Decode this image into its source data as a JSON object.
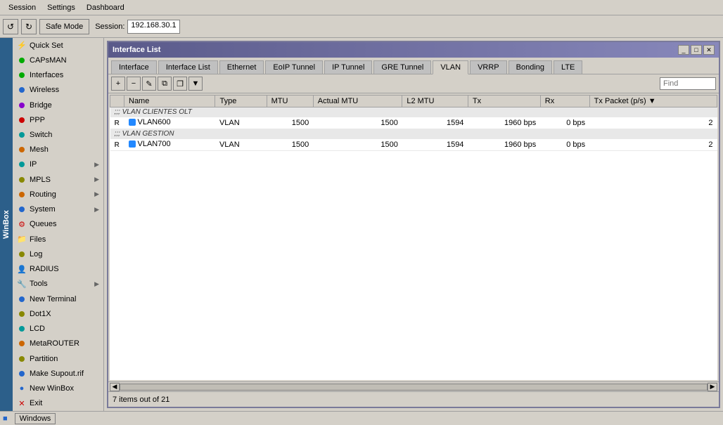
{
  "menubar": {
    "items": [
      "Session",
      "Settings",
      "Dashboard"
    ]
  },
  "toolbar": {
    "undo_label": "↺",
    "redo_label": "↻",
    "safemode_label": "Safe Mode",
    "session_label": "Session:",
    "session_value": "192.168.30.1"
  },
  "sidebar": {
    "items": [
      {
        "id": "quick-set",
        "label": "Quick Set",
        "icon": "⚡",
        "color": "#cc6600"
      },
      {
        "id": "capsman",
        "label": "CAPsMAN",
        "icon": "■",
        "color": "#00aa00"
      },
      {
        "id": "interfaces",
        "label": "Interfaces",
        "icon": "■",
        "color": "#00aa00",
        "active": true
      },
      {
        "id": "wireless",
        "label": "Wireless",
        "icon": "■",
        "color": "#0055cc"
      },
      {
        "id": "bridge",
        "label": "Bridge",
        "icon": "■",
        "color": "#8800aa"
      },
      {
        "id": "ppp",
        "label": "PPP",
        "icon": "■",
        "color": "#cc0000"
      },
      {
        "id": "switch",
        "label": "Switch",
        "icon": "■",
        "color": "#006688"
      },
      {
        "id": "mesh",
        "label": "Mesh",
        "icon": "■",
        "color": "#cc6600"
      },
      {
        "id": "ip",
        "label": "IP",
        "icon": "■",
        "color": "#006688",
        "expandable": true
      },
      {
        "id": "mpls",
        "label": "MPLS",
        "icon": "■",
        "color": "#888800",
        "expandable": true
      },
      {
        "id": "routing",
        "label": "Routing",
        "icon": "■",
        "color": "#cc6600",
        "expandable": true
      },
      {
        "id": "system",
        "label": "System",
        "icon": "■",
        "color": "#2266cc",
        "expandable": true
      },
      {
        "id": "queues",
        "label": "Queues",
        "icon": "⚙",
        "color": "#cc0000"
      },
      {
        "id": "files",
        "label": "Files",
        "icon": "📁",
        "color": "#006688"
      },
      {
        "id": "log",
        "label": "Log",
        "icon": "■",
        "color": "#888800"
      },
      {
        "id": "radius",
        "label": "RADIUS",
        "icon": "👤",
        "color": "#2266cc"
      },
      {
        "id": "tools",
        "label": "Tools",
        "icon": "🔧",
        "color": "#cc6600",
        "expandable": true
      },
      {
        "id": "new-terminal",
        "label": "New Terminal",
        "icon": "■",
        "color": "#2266cc"
      },
      {
        "id": "dot1x",
        "label": "Dot1X",
        "icon": "■",
        "color": "#888800"
      },
      {
        "id": "lcd",
        "label": "LCD",
        "icon": "■",
        "color": "#006688"
      },
      {
        "id": "metarouter",
        "label": "MetaROUTER",
        "icon": "■",
        "color": "#cc6600"
      },
      {
        "id": "partition",
        "label": "Partition",
        "icon": "■",
        "color": "#888800"
      },
      {
        "id": "make-supout",
        "label": "Make Supout.rif",
        "icon": "■",
        "color": "#2266cc"
      },
      {
        "id": "new-winbox",
        "label": "New WinBox",
        "icon": "●",
        "color": "#2266cc"
      },
      {
        "id": "exit",
        "label": "Exit",
        "icon": "✕",
        "color": "#cc0000"
      }
    ]
  },
  "window": {
    "title": "Interface List",
    "tabs": [
      {
        "id": "interface",
        "label": "Interface"
      },
      {
        "id": "interface-list",
        "label": "Interface List"
      },
      {
        "id": "ethernet",
        "label": "Ethernet"
      },
      {
        "id": "eoip-tunnel",
        "label": "EoIP Tunnel"
      },
      {
        "id": "ip-tunnel",
        "label": "IP Tunnel"
      },
      {
        "id": "gre-tunnel",
        "label": "GRE Tunnel"
      },
      {
        "id": "vlan",
        "label": "VLAN",
        "active": true
      },
      {
        "id": "vrrp",
        "label": "VRRP"
      },
      {
        "id": "bonding",
        "label": "Bonding"
      },
      {
        "id": "lte",
        "label": "LTE"
      }
    ],
    "toolbar": {
      "add": "+",
      "remove": "−",
      "edit": "✎",
      "copy": "⧉",
      "paste": "❐",
      "filter": "▼",
      "find_placeholder": "Find"
    },
    "table": {
      "columns": [
        "",
        "Name",
        "Type",
        "MTU",
        "Actual MTU",
        "L2 MTU",
        "Tx",
        "Rx",
        "Tx Packet (p/s)"
      ],
      "sections": [
        {
          "header": ";;; VLAN CLIENTES OLT",
          "rows": [
            {
              "flag": "R",
              "name": "VLAN600",
              "type": "VLAN",
              "mtu": "1500",
              "actual_mtu": "1500",
              "l2_mtu": "1594",
              "tx": "1960 bps",
              "rx": "0 bps",
              "tx_pkt": "2"
            }
          ]
        },
        {
          "header": ";;; VLAN GESTION",
          "rows": [
            {
              "flag": "R",
              "name": "VLAN700",
              "type": "VLAN",
              "mtu": "1500",
              "actual_mtu": "1500",
              "l2_mtu": "1594",
              "tx": "1960 bps",
              "rx": "0 bps",
              "tx_pkt": "2"
            }
          ]
        }
      ]
    },
    "statusbar": "7 items out of 21"
  },
  "windows_bar": {
    "label": "Windows",
    "icon": "■"
  }
}
